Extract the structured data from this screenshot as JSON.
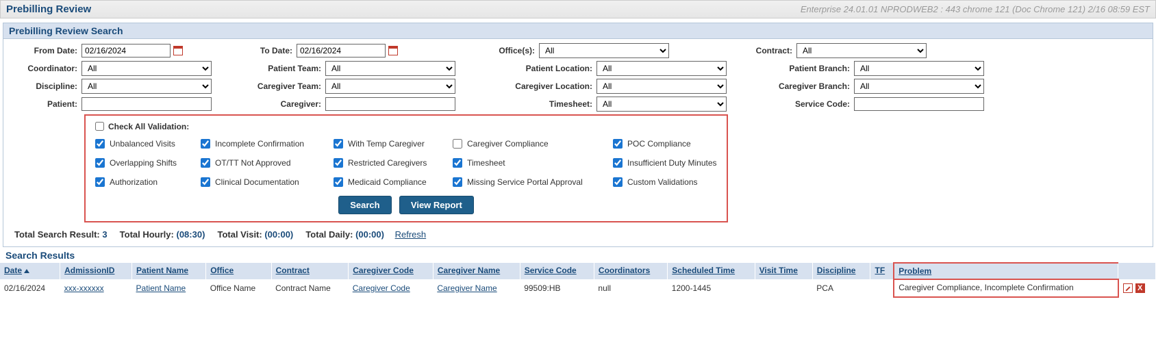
{
  "titlebar": {
    "left": "Prebilling Review",
    "right": "Enterprise 24.01.01 NPRODWEB2 : 443 chrome 121 (Doc Chrome 121) 2/16 08:59 EST"
  },
  "panel_title": "Prebilling Review Search",
  "filters": {
    "from_date_label": "From Date:",
    "from_date": "02/16/2024",
    "to_date_label": "To Date:",
    "to_date": "02/16/2024",
    "offices_label": "Office(s):",
    "offices": "All",
    "contract_label": "Contract:",
    "contract": "All",
    "coordinator_label": "Coordinator:",
    "coordinator": "All",
    "patient_team_label": "Patient Team:",
    "patient_team": "All",
    "patient_location_label": "Patient Location:",
    "patient_location": "All",
    "patient_branch_label": "Patient Branch:",
    "patient_branch": "All",
    "discipline_label": "Discipline:",
    "discipline": "All",
    "caregiver_team_label": "Caregiver Team:",
    "caregiver_team": "All",
    "caregiver_location_label": "Caregiver Location:",
    "caregiver_location": "All",
    "caregiver_branch_label": "Caregiver Branch:",
    "caregiver_branch": "All",
    "patient_label": "Patient:",
    "patient": "",
    "caregiver_label": "Caregiver:",
    "caregiver": "",
    "timesheet_label": "Timesheet:",
    "timesheet": "All",
    "service_code_label": "Service Code:",
    "service_code": ""
  },
  "validation": {
    "check_all_label": "Check All Validation:",
    "items": {
      "unbalanced_visits": "Unbalanced Visits",
      "incomplete_confirmation": "Incomplete Confirmation",
      "with_temp_caregiver": "With Temp Caregiver",
      "caregiver_compliance": "Caregiver Compliance",
      "poc_compliance": "POC Compliance",
      "overlapping_shifts": "Overlapping Shifts",
      "ot_tt_not_approved": "OT/TT Not Approved",
      "restricted_caregivers": "Restricted Caregivers",
      "timesheet": "Timesheet",
      "insufficient_duty_minutes": "Insufficient Duty Minutes",
      "authorization": "Authorization",
      "clinical_documentation": "Clinical Documentation",
      "medicaid_compliance": "Medicaid Compliance",
      "missing_service_portal_approval": "Missing Service Portal Approval",
      "custom_validations": "Custom Validations"
    }
  },
  "buttons": {
    "search": "Search",
    "view_report": "View Report"
  },
  "summary": {
    "total_search_label": "Total Search Result:",
    "total_search": "3",
    "total_hourly_label": "Total Hourly:",
    "total_hourly": "(08:30)",
    "total_visit_label": "Total Visit:",
    "total_visit": "(00:00)",
    "total_daily_label": "Total Daily:",
    "total_daily": "(00:00)",
    "refresh": "Refresh"
  },
  "results_title": "Search Results",
  "columns": {
    "date": "Date",
    "admission_id": "AdmissionID",
    "patient_name": "Patient Name",
    "office": "Office",
    "contract": "Contract",
    "caregiver_code": "Caregiver Code",
    "caregiver_name": "Caregiver Name",
    "service_code": "Service Code",
    "coordinators": "Coordinators",
    "scheduled_time": "Scheduled Time",
    "visit_time": "Visit Time",
    "discipline": "Discipline",
    "tf": "TF",
    "problem": "Problem"
  },
  "rows": [
    {
      "date": "02/16/2024",
      "admission_id": "xxx-xxxxxx",
      "patient_name": "Patient Name",
      "office": "Office Name",
      "contract": "Contract Name",
      "caregiver_code": "Caregiver Code",
      "caregiver_name": "Caregiver Name",
      "service_code": "99509:HB",
      "coordinators": "null",
      "scheduled_time": "1200-1445",
      "visit_time": "",
      "discipline": "PCA",
      "tf": "",
      "problem": "Caregiver Compliance, Incomplete Confirmation"
    }
  ]
}
